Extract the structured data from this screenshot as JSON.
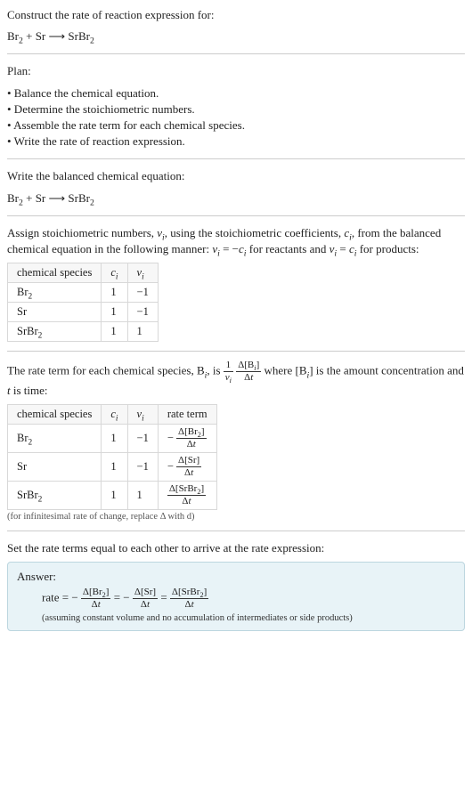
{
  "intro": {
    "title": "Construct the rate of reaction expression for:",
    "reaction_html": "Br<sub class='sub'>2</sub> + Sr ⟶ SrBr<sub class='sub'>2</sub>"
  },
  "plan": {
    "heading": "Plan:",
    "items": [
      "• Balance the chemical equation.",
      "• Determine the stoichiometric numbers.",
      "• Assemble the rate term for each chemical species.",
      "• Write the rate of reaction expression."
    ]
  },
  "balanced": {
    "heading": "Write the balanced chemical equation:",
    "reaction_html": "Br<sub class='sub'>2</sub> + Sr ⟶ SrBr<sub class='sub'>2</sub>"
  },
  "stoich_intro_html": "Assign stoichiometric numbers, <span class='ital'>ν<sub class='sub'>i</sub></span>, using the stoichiometric coefficients, <span class='ital'>c<sub class='sub'>i</sub></span>, from the balanced chemical equation in the following manner: <span class='ital'>ν<sub class='sub'>i</sub></span> = −<span class='ital'>c<sub class='sub'>i</sub></span> for reactants and <span class='ital'>ν<sub class='sub'>i</sub></span> = <span class='ital'>c<sub class='sub'>i</sub></span> for products:",
  "table1": {
    "h_species": "chemical species",
    "h_c": "cᵢ",
    "h_v": "νᵢ",
    "rows": [
      {
        "sp_html": "Br<sub class='sub'>2</sub>",
        "c": "1",
        "v": "−1"
      },
      {
        "sp_html": "Sr",
        "c": "1",
        "v": "−1"
      },
      {
        "sp_html": "SrBr<sub class='sub'>2</sub>",
        "c": "1",
        "v": "1"
      }
    ]
  },
  "rate_term_intro_html": "The rate term for each chemical species, B<span class='ital'><sub class='sub'>i</sub></span>, is <span class='eq-inline'><span class='fracwrap'><span class='num'>1</span><span class='den'><span class='ital'>ν<sub class='sub'>i</sub></span></span></span> <span class='fracwrap'><span class='num'>Δ[B<sub class='sub'><span class='ital'>i</span></sub>]</span><span class='den'>Δ<span class='ital'>t</span></span></span></span> where [B<span class='ital'><sub class='sub'>i</sub></span>] is the amount concentration and <span class='ital'>t</span> is time:",
  "table2": {
    "h_species": "chemical species",
    "h_c": "cᵢ",
    "h_v": "νᵢ",
    "h_rate": "rate term",
    "rows": [
      {
        "sp_html": "Br<sub class='sub'>2</sub>",
        "c": "1",
        "v": "−1",
        "rate_html": "− <span class='fracwrap'><span class='num'>Δ[Br<sub class='sub'>2</sub>]</span><span class='den'>Δ<span class='ital'>t</span></span></span>"
      },
      {
        "sp_html": "Sr",
        "c": "1",
        "v": "−1",
        "rate_html": "− <span class='fracwrap'><span class='num'>Δ[Sr]</span><span class='den'>Δ<span class='ital'>t</span></span></span>"
      },
      {
        "sp_html": "SrBr<sub class='sub'>2</sub>",
        "c": "1",
        "v": "1",
        "rate_html": "<span class='fracwrap'><span class='num'>Δ[SrBr<sub class='sub'>2</sub>]</span><span class='den'>Δ<span class='ital'>t</span></span></span>"
      }
    ],
    "note": "(for infinitesimal rate of change, replace Δ with d)"
  },
  "final_heading": "Set the rate terms equal to each other to arrive at the rate expression:",
  "answer": {
    "label": "Answer:",
    "expr_html": "rate = − <span class='fracwrap'><span class='num'>Δ[Br<sub class='sub'>2</sub>]</span><span class='den'>Δ<span class='ital'>t</span></span></span> = − <span class='fracwrap'><span class='num'>Δ[Sr]</span><span class='den'>Δ<span class='ital'>t</span></span></span> = <span class='fracwrap'><span class='num'>Δ[SrBr<sub class='sub'>2</sub>]</span><span class='den'>Δ<span class='ital'>t</span></span></span>",
    "note": "(assuming constant volume and no accumulation of intermediates or side products)"
  }
}
